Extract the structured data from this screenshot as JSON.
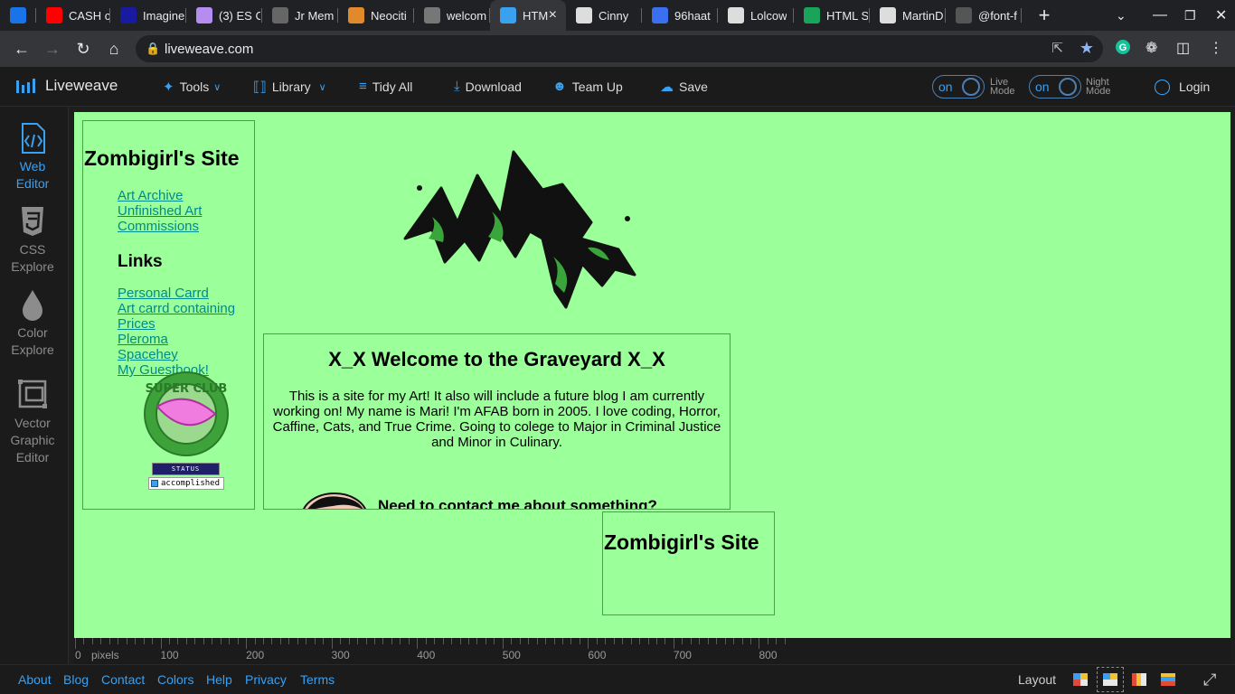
{
  "browser": {
    "tabs": [
      {
        "label": "",
        "icon": "r-icon",
        "color": "#1a73e8"
      },
      {
        "label": "CASH c",
        "icon": "youtube-icon",
        "color": "#ff0000"
      },
      {
        "label": "Imagine",
        "icon": "imagine-icon",
        "color": "#1a1aa0"
      },
      {
        "label": "(3) ES C",
        "icon": "cloud-icon",
        "color": "#b58cf0"
      },
      {
        "label": "Jr Mem",
        "icon": "image-icon",
        "color": "#666666"
      },
      {
        "label": "Neociti",
        "icon": "cat-icon",
        "color": "#e08a2c"
      },
      {
        "label": "welcom",
        "icon": "globe-icon",
        "color": "#777777"
      },
      {
        "label": "HTM",
        "icon": "liveweave-icon",
        "color": "#3aa0f0",
        "active": true
      },
      {
        "label": "Cinny",
        "icon": "cinny-icon",
        "color": "#dddddd"
      },
      {
        "label": "96haat",
        "icon": "people-icon",
        "color": "#3a6ff0"
      },
      {
        "label": "Lolcow",
        "icon": "lolcow-icon",
        "color": "#dddddd"
      },
      {
        "label": "HTML S",
        "icon": "w-icon",
        "color": "#1aa35a"
      },
      {
        "label": "MartinD",
        "icon": "martin-icon",
        "color": "#dddddd"
      },
      {
        "label": "@font-f",
        "icon": "font-icon",
        "color": "#555555"
      }
    ],
    "url": "liveweave.com"
  },
  "toolbar": {
    "app_name": "Liveweave",
    "tools": "Tools",
    "library": "Library",
    "tidy_all": "Tidy All",
    "download": "Download",
    "team_up": "Team Up",
    "save": "Save",
    "live_toggle": "on",
    "live_label_1": "Live",
    "live_label_2": "Mode",
    "night_toggle": "on",
    "night_label_1": "Night",
    "night_label_2": "Mode",
    "login": "Login"
  },
  "sidebar": {
    "items": [
      {
        "line1": "Web",
        "line2": "Editor",
        "line3": ""
      },
      {
        "line1": "CSS",
        "line2": "Explore",
        "line3": ""
      },
      {
        "line1": "Color",
        "line2": "Explore",
        "line3": ""
      },
      {
        "line1": "Vector",
        "line2": "Graphic",
        "line3": "Editor"
      }
    ]
  },
  "preview": {
    "background": "#9bff9a",
    "side_title": "Zombigirl's Site",
    "nav_links": [
      "Art Archive",
      "Unfinished Art",
      "Commissions"
    ],
    "links_heading": "Links",
    "links": [
      "Personal Carrd",
      "Art carrd containing",
      "Prices",
      "Pleroma",
      "Spacehey",
      "My Guestbook!"
    ],
    "badge_text": "SUPER CLUB",
    "status_button": "STATUS",
    "status_text": "accomplished",
    "logo_text": "MARI",
    "welcome_title": "X_X Welcome to the Graveyard X_X",
    "welcome_body": "This is a site for my Art! It also will include a future blog I am currently working on! My name is Mari! I'm AFAB born in 2005. I love coding, Horror, Caffine, Cats, and True Crime. Going to colege to Major in Criminal Justice and Minor in Culinary.",
    "contact_heading": "Need to contact me about something?",
    "footer_box_title": "Zombigirl's Site"
  },
  "ruler": {
    "unit": "pixels",
    "labels": [
      "0",
      "100",
      "200",
      "300",
      "400",
      "500",
      "600",
      "700",
      "800"
    ]
  },
  "footer": {
    "links": [
      "About",
      "Blog",
      "Contact",
      "Colors",
      "Help",
      "Privacy",
      "Terms"
    ],
    "layout_label": "Layout"
  }
}
